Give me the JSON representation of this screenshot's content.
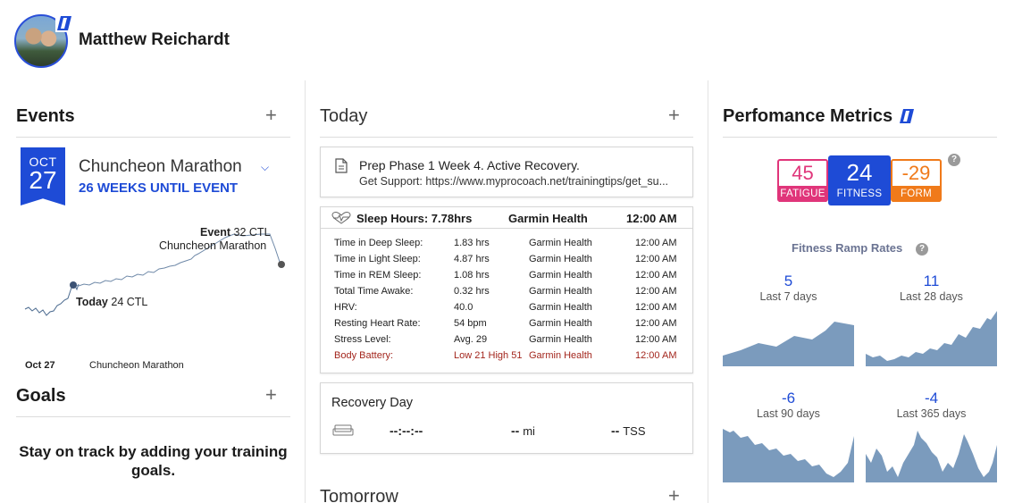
{
  "user": {
    "name": "Matthew Reichardt"
  },
  "events": {
    "title": "Events",
    "add_icon": "+",
    "badge_month": "OCT",
    "badge_day": "27",
    "event_name": "Chuncheon Marathon",
    "weeks_until": "26 WEEKS UNTIL EVENT",
    "chart": {
      "event_label_bold": "Event",
      "event_label_ctl": "32 CTL",
      "event_label_name": "Chuncheon Marathon",
      "today_label_bold": "Today",
      "today_label_ctl": "24 CTL"
    },
    "footer_date": "Oct 27",
    "footer_event": "Chuncheon Marathon"
  },
  "goals": {
    "title": "Goals",
    "add_icon": "+",
    "empty_text": "Stay on track by adding your training goals."
  },
  "today": {
    "title": "Today",
    "add_icon": "+",
    "plan": {
      "title": "Prep Phase 1 Week 4. Active Recovery.",
      "support": "Get Support: https://www.myprocoach.net/trainingtips/get_su..."
    },
    "sleep_header": {
      "label": "Sleep Hours: 7.78hrs",
      "source": "Garmin Health",
      "time": "12:00 AM"
    },
    "metrics": [
      {
        "name": "Time in Deep Sleep:",
        "value": "1.83 hrs",
        "source": "Garmin Health",
        "time": "12:00 AM",
        "alert": false
      },
      {
        "name": "Time in Light Sleep:",
        "value": "4.87 hrs",
        "source": "Garmin Health",
        "time": "12:00 AM",
        "alert": false
      },
      {
        "name": "Time in REM Sleep:",
        "value": "1.08 hrs",
        "source": "Garmin Health",
        "time": "12:00 AM",
        "alert": false
      },
      {
        "name": "Total Time Awake:",
        "value": "0.32 hrs",
        "source": "Garmin Health",
        "time": "12:00 AM",
        "alert": false
      },
      {
        "name": "HRV:",
        "value": "40.0",
        "source": "Garmin Health",
        "time": "12:00 AM",
        "alert": false
      },
      {
        "name": "Resting Heart Rate:",
        "value": "54 bpm",
        "source": "Garmin Health",
        "time": "12:00 AM",
        "alert": false
      },
      {
        "name": "Stress Level:",
        "value": "Avg. 29",
        "source": "Garmin Health",
        "time": "12:00 AM",
        "alert": false
      },
      {
        "name": "Body Battery:",
        "value": "Low 21 High 51",
        "source": "Garmin Health",
        "time": "12:00 AM",
        "alert": true
      }
    ],
    "recovery": {
      "title": "Recovery Day",
      "duration": "--:--:--",
      "distance": "--",
      "distance_unit": "mi",
      "tss": "--",
      "tss_unit": "TSS"
    }
  },
  "tomorrow": {
    "title": "Tomorrow",
    "add_icon": "+"
  },
  "performance": {
    "title": "Perfomance Metrics",
    "fatigue": {
      "value": "45",
      "label": "FATIGUE",
      "color": "#e0357a"
    },
    "fitness": {
      "value": "24",
      "label": "FITNESS",
      "color": "#1e4bd6"
    },
    "form": {
      "value": "-29",
      "label": "FORM",
      "color": "#f07a1a"
    },
    "help_icon": "?",
    "ramp_title": "Fitness Ramp Rates",
    "ramps": [
      {
        "value": "5",
        "period": "Last 7 days"
      },
      {
        "value": "11",
        "period": "Last 28 days"
      },
      {
        "value": "-6",
        "period": "Last 90 days"
      },
      {
        "value": "-4",
        "period": "Last 365 days"
      }
    ],
    "spark_color": "#7b9bbd"
  }
}
